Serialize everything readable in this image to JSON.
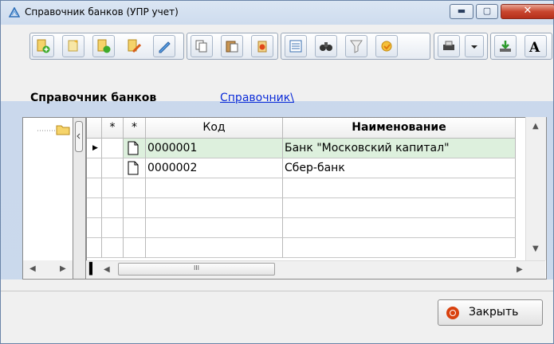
{
  "window": {
    "title": "Справочник банков (УПР учет)"
  },
  "window_controls": {
    "minimize": "▬",
    "maximize": "▢",
    "close": "✕"
  },
  "toolbar": {
    "buttons": [
      "add-icon",
      "add-copy-icon",
      "add-group-icon",
      "edit-icon",
      "copy-icon",
      "paste-icon",
      "delete-icon",
      "list-icon",
      "find-icon",
      "filter-icon",
      "refresh-icon",
      "print-icon",
      "dropdown-icon",
      "export-icon",
      "font-icon"
    ]
  },
  "heading": {
    "title": "Справочник банков",
    "link": "Справочник\\"
  },
  "grid": {
    "columns": [
      {
        "key": "mark1",
        "label": "*"
      },
      {
        "key": "mark2",
        "label": "*"
      },
      {
        "key": "code",
        "label": "Код"
      },
      {
        "key": "name",
        "label": "Наименование"
      }
    ],
    "rows": [
      {
        "code": "0000001",
        "name": "Банк \"Московский капитал\""
      },
      {
        "code": "0000002",
        "name": "Сбер-банк"
      }
    ]
  },
  "scroll": {
    "hthumb_label": "III"
  },
  "footer": {
    "close_label": "Закрыть"
  },
  "colors": {
    "selected_row": "#ddf0dd",
    "link": "#0a2bd8",
    "close_icon": "#d9410e"
  }
}
